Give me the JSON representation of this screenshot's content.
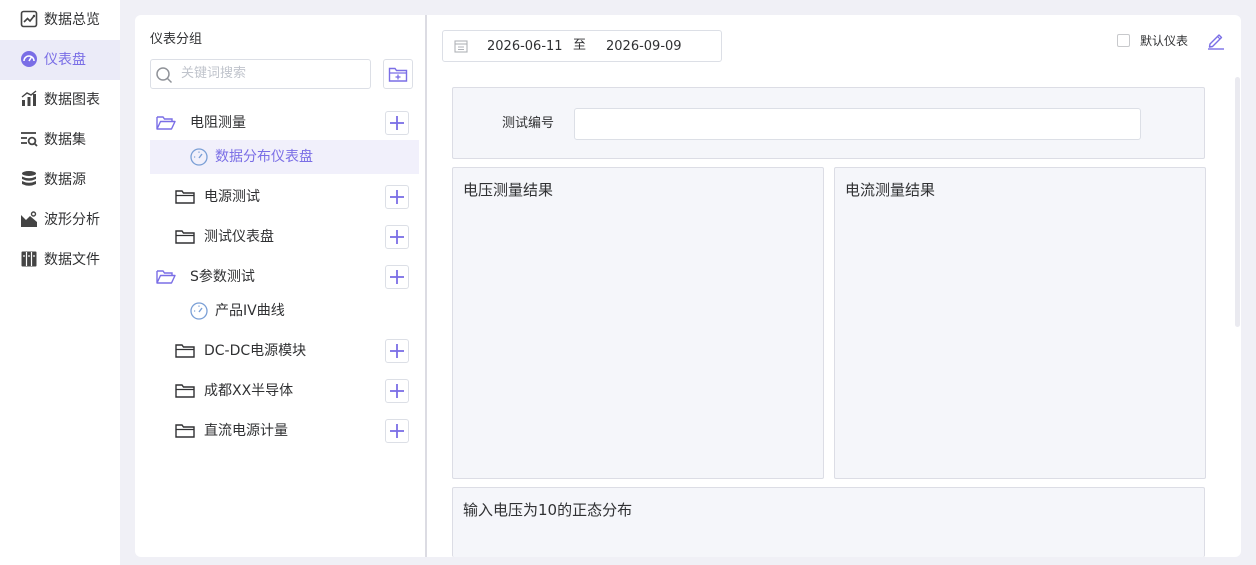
{
  "nav": {
    "items": [
      {
        "label": "数据总览",
        "icon": "dashboard-overview-icon"
      },
      {
        "label": "仪表盘",
        "icon": "gauge-icon",
        "active": true
      },
      {
        "label": "数据图表",
        "icon": "bar-chart-icon"
      },
      {
        "label": "数据集",
        "icon": "dataset-search-icon"
      },
      {
        "label": "数据源",
        "icon": "database-icon"
      },
      {
        "label": "波形分析",
        "icon": "waveform-icon"
      },
      {
        "label": "数据文件",
        "icon": "file-cabinet-icon"
      }
    ]
  },
  "groups": {
    "title": "仪表分组",
    "search_placeholder": "关键词搜索",
    "tree": [
      {
        "label": "电阻测量",
        "type": "folder",
        "open": true
      },
      {
        "label": "数据分布仪表盘",
        "type": "dashboard",
        "selected": true
      },
      {
        "label": "电源测试",
        "type": "folder"
      },
      {
        "label": "测试仪表盘",
        "type": "folder"
      },
      {
        "label": "S参数测试",
        "type": "folder",
        "open": true
      },
      {
        "label": "产品IV曲线",
        "type": "dashboard"
      },
      {
        "label": "DC-DC电源模块",
        "type": "folder"
      },
      {
        "label": "成都XX半导体",
        "type": "folder"
      },
      {
        "label": "直流电源计量",
        "type": "folder"
      }
    ]
  },
  "toolbar": {
    "date_start": "2026-06-11",
    "date_separator": "至",
    "date_end": "2026-09-09",
    "default_label": "默认仪表"
  },
  "dashboard": {
    "filter_label": "测试编号",
    "filter_value": "",
    "panels": {
      "voltage": "电压测量结果",
      "current": "电流测量结果",
      "normal": "输入电压为10的正态分布"
    }
  },
  "colors": {
    "accent": "#7a6ee6",
    "active_bg": "#ebebf8",
    "page_bg": "#f0f0f6",
    "panel_bg": "#f5f6fa"
  }
}
